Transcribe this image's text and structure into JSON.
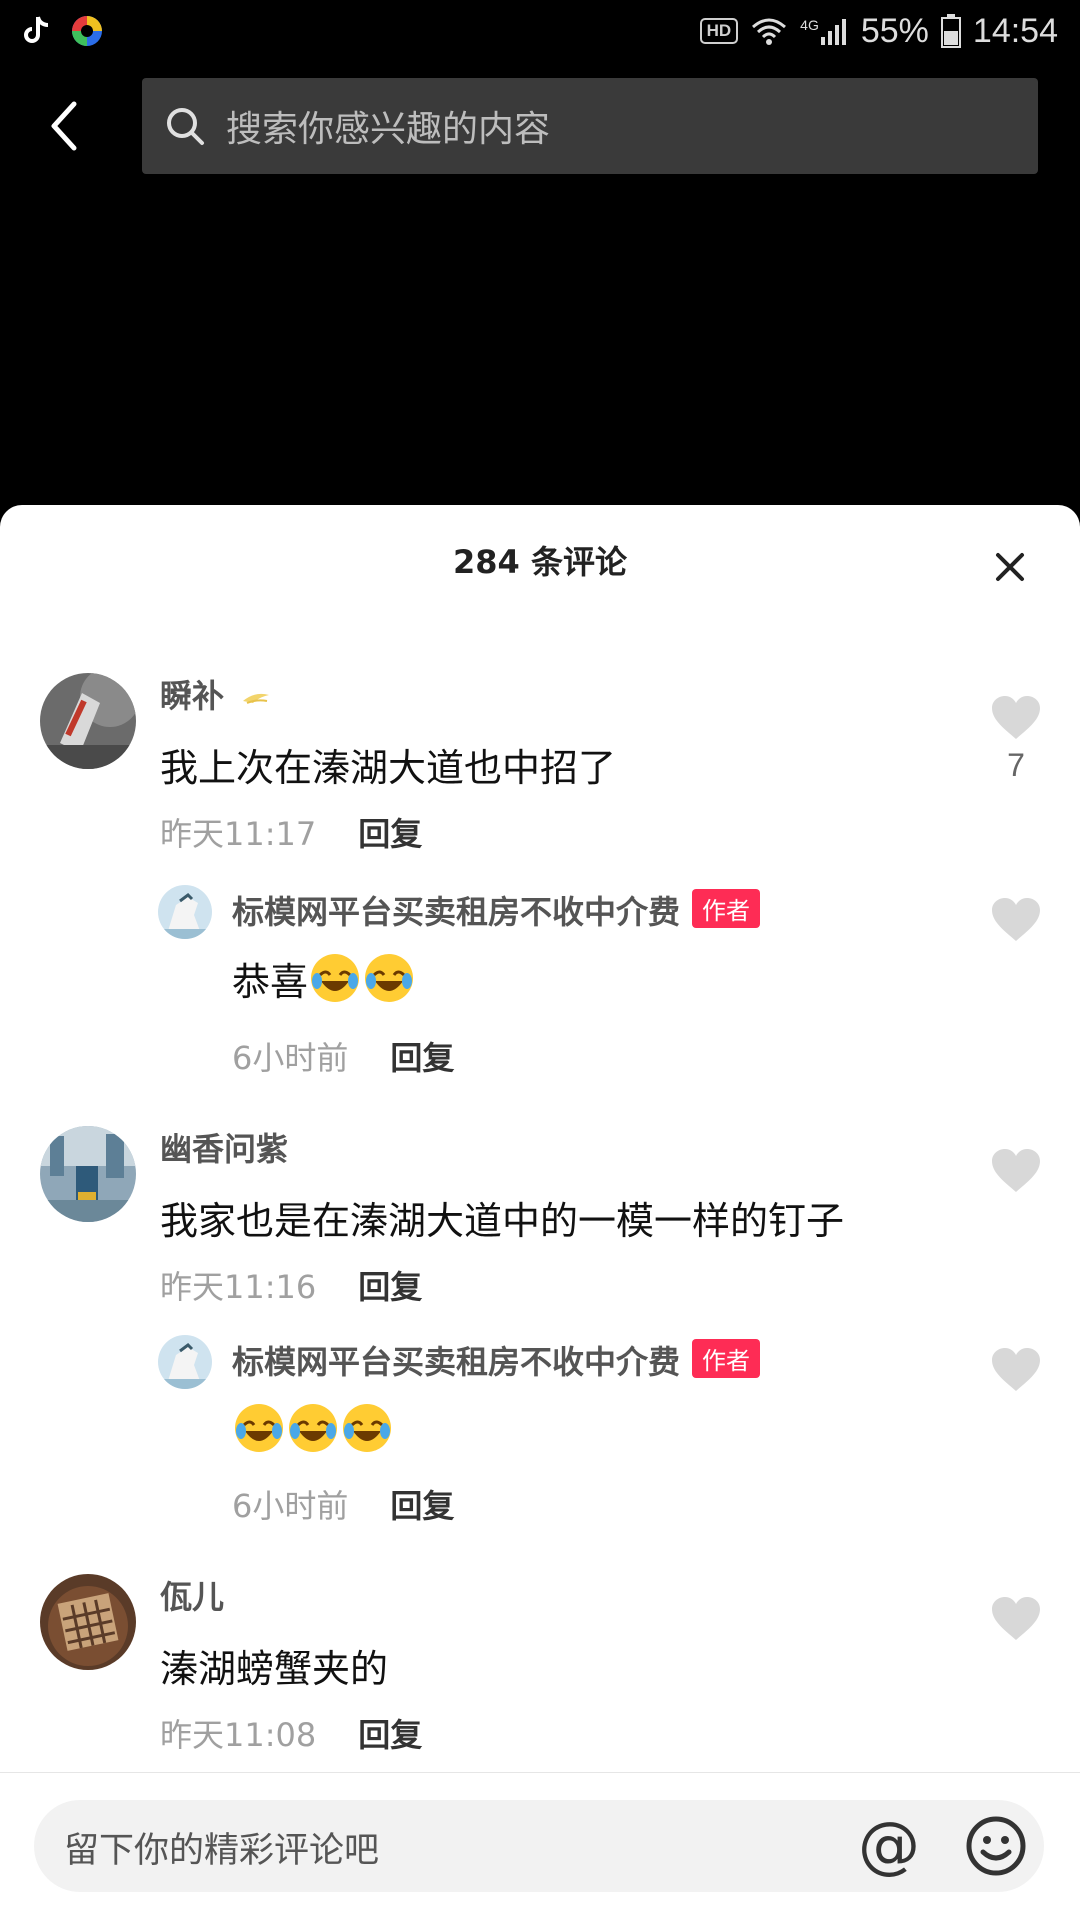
{
  "status_bar": {
    "hd": "HD",
    "network": "4G",
    "battery": "55%",
    "time": "14:54"
  },
  "search": {
    "placeholder": "搜索你感兴趣的内容"
  },
  "sheet": {
    "title": "284 条评论"
  },
  "comments": [
    {
      "user": "瞬补",
      "text": "我上次在溱湖大道也中招了",
      "time": "昨天11:17",
      "reply": "回复",
      "likes": "7",
      "reply_item": {
        "user": "标模网平台买卖租房不收中介费",
        "badge": "作者",
        "text": "恭喜",
        "time": "6小时前",
        "reply": "回复"
      }
    },
    {
      "user": "幽香问紫",
      "text": "我家也是在溱湖大道中的一模一样的钉子",
      "time": "昨天11:16",
      "reply": "回复",
      "reply_item": {
        "user": "标模网平台买卖租房不收中介费",
        "badge": "作者",
        "time": "6小时前",
        "reply": "回复"
      }
    },
    {
      "user": "佤儿",
      "text": "溱湖螃蟹夹的",
      "time": "昨天11:08",
      "reply": "回复"
    }
  ],
  "input": {
    "placeholder": "留下你的精彩评论吧",
    "at_symbol": "@"
  },
  "colors": {
    "accent": "#fe2c55",
    "background_top": "#000000",
    "sheet": "#ffffff"
  }
}
